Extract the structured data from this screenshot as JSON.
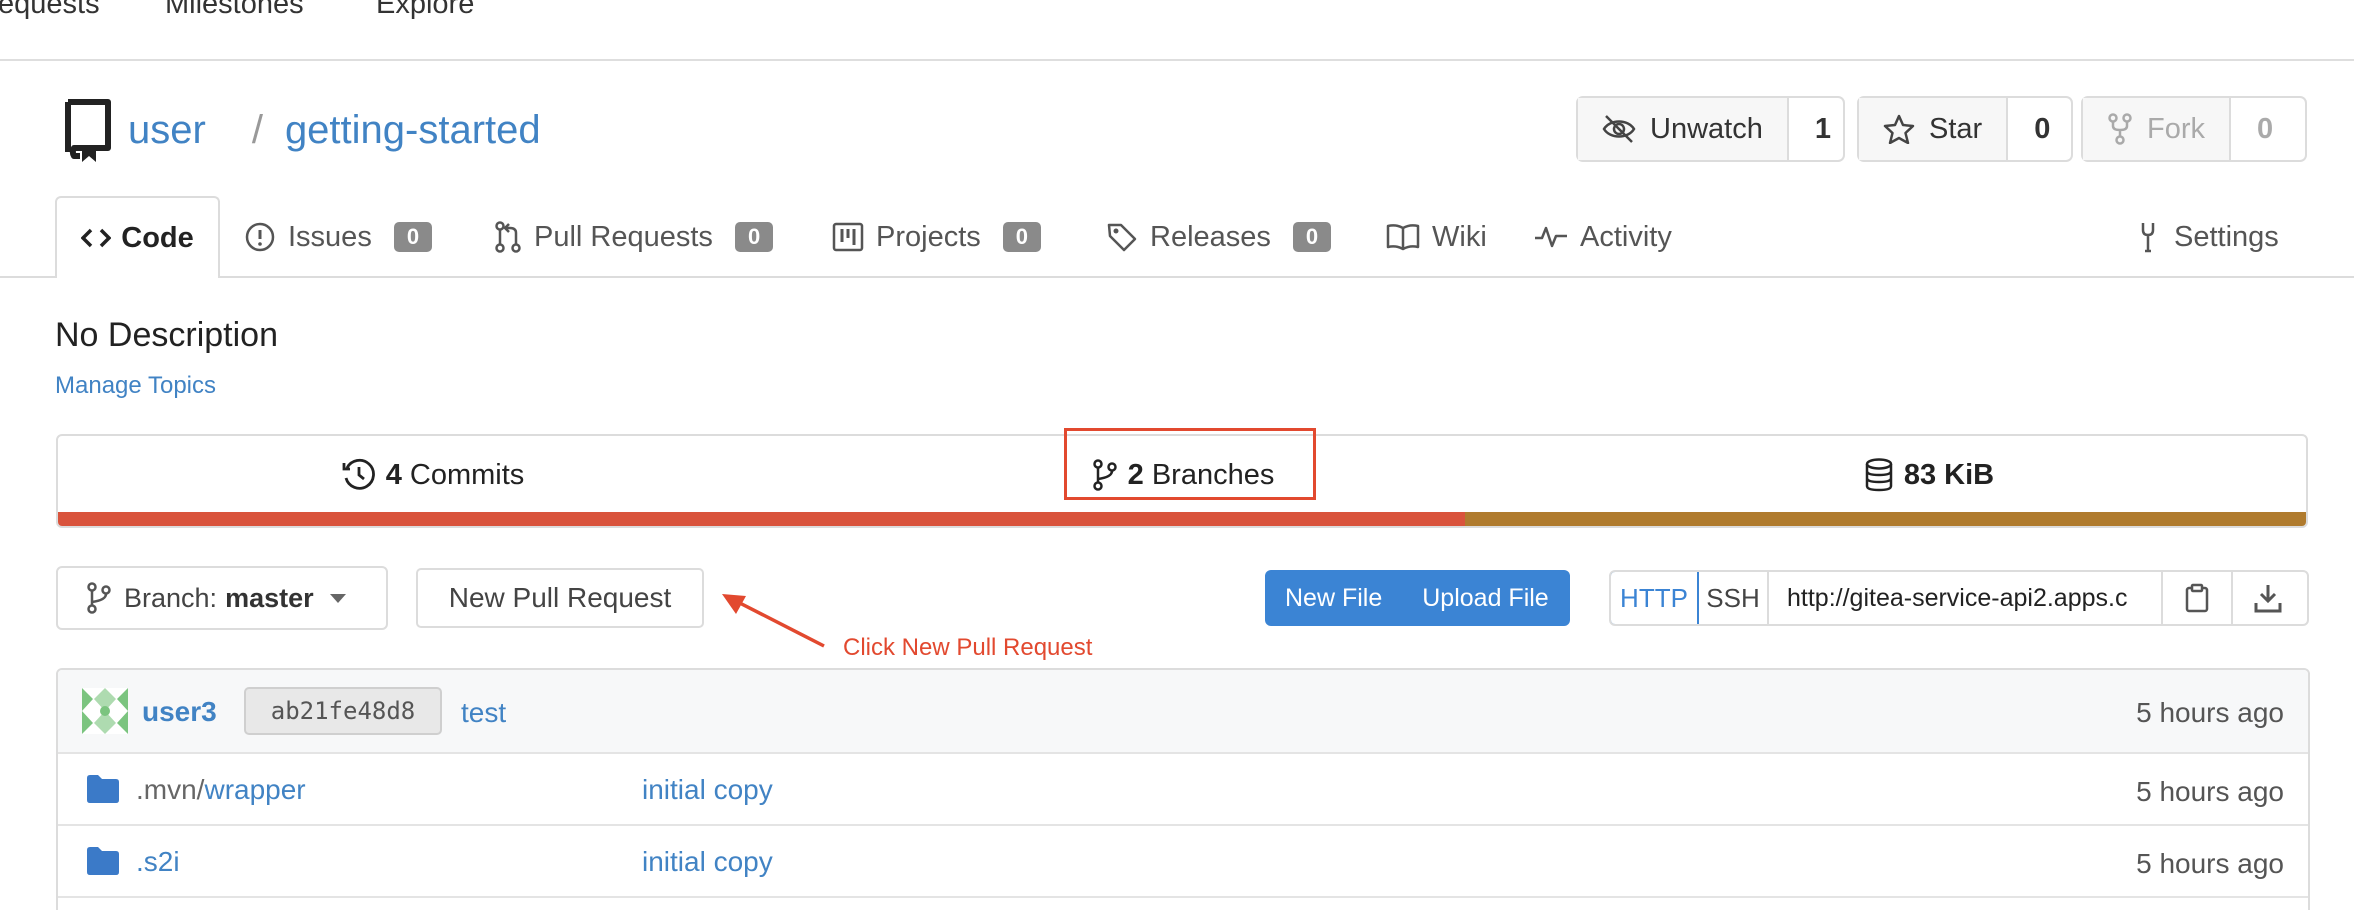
{
  "topnav": {
    "items": [
      "equests",
      "Milestones",
      "Explore"
    ]
  },
  "repo": {
    "owner": "user",
    "separator": "/",
    "name": "getting-started"
  },
  "actions": {
    "watch": {
      "label": "Unwatch",
      "count": "1"
    },
    "star": {
      "label": "Star",
      "count": "0"
    },
    "fork": {
      "label": "Fork",
      "count": "0"
    }
  },
  "tabs": {
    "code": "Code",
    "issues": {
      "label": "Issues",
      "count": "0"
    },
    "pulls": {
      "label": "Pull Requests",
      "count": "0"
    },
    "projects": {
      "label": "Projects",
      "count": "0"
    },
    "releases": {
      "label": "Releases",
      "count": "0"
    },
    "wiki": "Wiki",
    "activity": "Activity",
    "settings": "Settings"
  },
  "description": "No Description",
  "manage_topics": "Manage Topics",
  "stats": {
    "commits_count": "4",
    "commits_label": "Commits",
    "branches_count": "2",
    "branches_label": "Branches",
    "size": "83 KiB"
  },
  "language_bar": [
    {
      "fraction": 0.626,
      "color": "#d9533c"
    },
    {
      "fraction": 0.374,
      "color": "#b07b2e"
    }
  ],
  "toolbar": {
    "branch_prefix": "Branch:",
    "branch_name": "master",
    "new_pull_request": "New Pull Request",
    "new_file": "New File",
    "upload_file": "Upload File",
    "http": "HTTP",
    "ssh": "SSH",
    "clone_url": "http://gitea-service-api2.apps.c"
  },
  "annotation": "Click New Pull Request",
  "latest_commit": {
    "author": "user3",
    "sha": "ab21fe48d8",
    "message": "test",
    "time": "5 hours ago"
  },
  "files": [
    {
      "prefix": ".mvn/",
      "name": "wrapper",
      "commit": "initial copy",
      "time": "5 hours ago"
    },
    {
      "prefix": "",
      "name": ".s2i",
      "commit": "initial copy",
      "time": "5 hours ago"
    }
  ],
  "colors": {
    "link": "#4183c4",
    "primary_button": "#3b84d4",
    "highlight": "#e2492f",
    "folder": "#3b7ac8"
  }
}
